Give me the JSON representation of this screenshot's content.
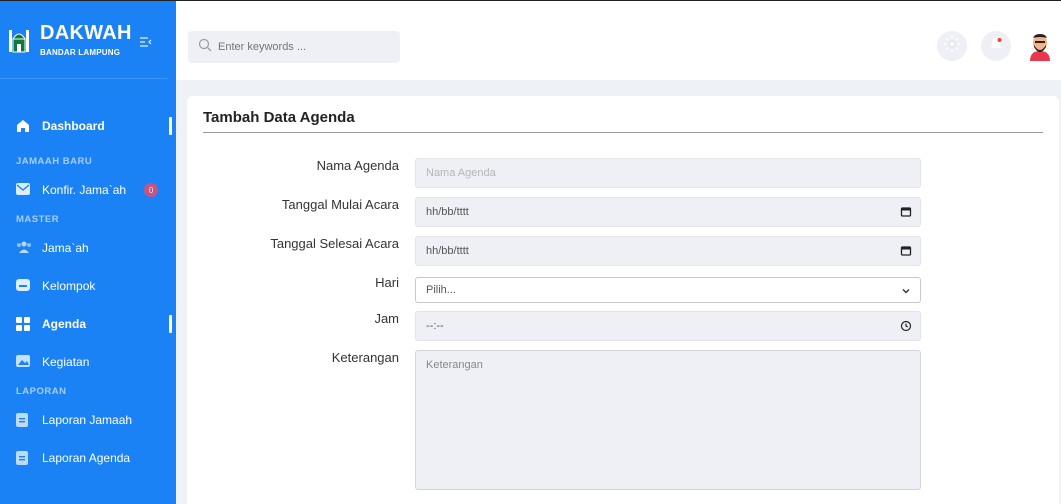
{
  "brand": {
    "title": "DAKWAH",
    "subtitle": "BANDAR LAMPUNG",
    "toggle": "☰"
  },
  "sidebar": {
    "dashboard": "Dashboard",
    "section_jamaah_baru": "JAMAAH BARU",
    "konfirmasi": "Konfir. Jama`ah",
    "konfirmasi_badge": "0",
    "section_master": "MASTER",
    "jamaah": "Jama`ah",
    "kelompok": "Kelompok",
    "agenda": "Agenda",
    "kegiatan": "Kegiatan",
    "section_laporan": "LAPORAN",
    "laporan_jamaah": "Laporan Jamaah",
    "laporan_agenda": "Laporan Agenda"
  },
  "search": {
    "placeholder": "Enter keywords ..."
  },
  "form": {
    "title": "Tambah Data Agenda",
    "nama_label": "Nama Agenda",
    "nama_placeholder": "Nama Agenda",
    "mulai_label": "Tanggal Mulai Acara",
    "mulai_value": "hh/bb/tttt",
    "selesai_label": "Tanggal Selesai Acara",
    "selesai_value": "hh/bb/tttt",
    "hari_label": "Hari",
    "hari_value": "Pilih...",
    "jam_label": "Jam",
    "jam_value": "--:--",
    "keterangan_label": "Keterangan",
    "keterangan_placeholder": "Keterangan"
  },
  "colors": {
    "sidebar": "#1b82f5",
    "main_bg": "#eef1f6",
    "badge": "#e74c6e"
  }
}
